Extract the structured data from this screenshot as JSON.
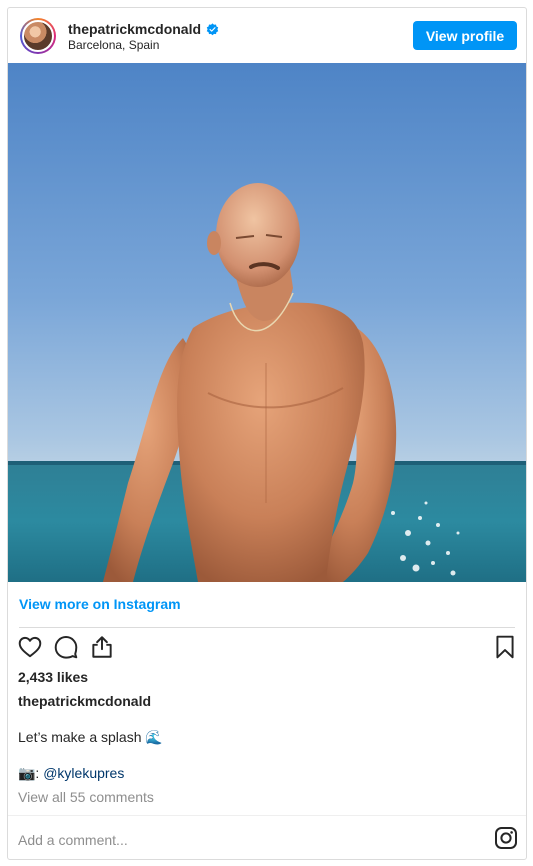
{
  "post": {
    "username": "thepatrickmcdonald",
    "location": "Barcelona, Spain",
    "view_profile_label": "View profile",
    "view_more_label": "View more on Instagram",
    "likes": "2,433 likes",
    "caption_user": "thepatrickmcdonald",
    "caption_text": "Let’s make a splash 🌊",
    "credit_prefix": "📷: ",
    "credit_mention": "@kylekupres",
    "view_comments": "View all 55 comments",
    "add_comment_placeholder": "Add a comment..."
  },
  "icons": {
    "verified": "verified-badge-icon",
    "like": "heart-icon",
    "comment": "comment-bubble-icon",
    "share": "share-icon",
    "save": "bookmark-icon",
    "brand": "instagram-logo-icon"
  },
  "colors": {
    "accent": "#0095f6",
    "text": "#262626",
    "muted": "#8e8e8e",
    "mention": "#00376b",
    "border": "#dbdbdb"
  }
}
